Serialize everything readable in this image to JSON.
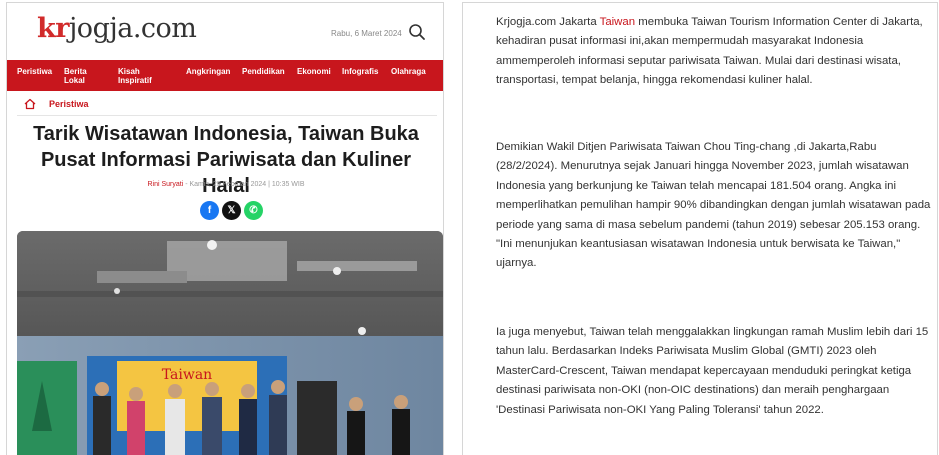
{
  "header": {
    "logo_part1": "kr",
    "logo_part2": "jogja.com",
    "date": "Rabu, 6 Maret 2024"
  },
  "nav": [
    {
      "label": "Peristiwa"
    },
    {
      "label": "Berita Lokal"
    },
    {
      "label": "Kisah Inspiratif"
    },
    {
      "label": "Angkringan"
    },
    {
      "label": "Pendidikan"
    },
    {
      "label": "Ekonomi"
    },
    {
      "label": "Infografis"
    },
    {
      "label": "Olahraga"
    }
  ],
  "breadcrumb": {
    "label": "Peristiwa"
  },
  "article": {
    "title": "Tarik Wisatawan Indonesia, Taiwan Buka Pusat Informasi Pariwisata dan Kuliner Halal",
    "author": "Rini Suryati",
    "meta_rest": " - Kamis, 29 Februari 2024 | 10:35 WIB",
    "photo_banner_text": "Taiwan",
    "p1_a": "Krjogja.com Jakarta ",
    "p1_link": "Taiwan",
    "p1_b": " membuka Taiwan Tourism Information Center di Jakarta, kehadiran pusat informasi ini,akan mempermudah masyarakat Indonesia ammemperoleh informasi seputar pariwisata Taiwan. Mulai dari destinasi wisata, transportasi, tempat belanja, hingga rekomendasi kuliner halal.",
    "p2": "Demikian Wakil Ditjen Pariwisata Taiwan Chou Ting-chang ,di Jakarta,Rabu (28/2/2024). Menurutnya sejak Januari hingga November 2023, jumlah wisatawan Indonesia yang berkunjung ke Taiwan telah mencapai 181.504 orang. Angka ini memperlihatkan pemulihan hampir 90% dibandingkan dengan jumlah wisatawan pada periode yang sama di masa sebelum pandemi (tahun 2019) sebesar 205.153 orang. \"Ini menunjukan keantusiasan wisatawan Indonesia untuk berwisata ke Taiwan,\" ujarnya.",
    "p3": "Ia juga menyebut, Taiwan telah menggalakkan lingkungan ramah Muslim lebih dari 15 tahun lalu. Berdasarkan Indeks Pariwisata Muslim Global (GMTI) 2023 oleh MasterCard-Crescent, Taiwan mendapat kepercayaan menduduki peringkat ketiga destinasi pariwisata non-OKI (non-OIC destinations) dan meraih penghargaan 'Destinasi Pariwisata non-OKI Yang Paling Toleransi' tahun 2022."
  },
  "share": [
    {
      "icon": "facebook-icon",
      "glyph": "f",
      "color": "#1877f2"
    },
    {
      "icon": "x-icon",
      "glyph": "𝕏",
      "color": "#111111"
    },
    {
      "icon": "whatsapp-icon",
      "glyph": "✆",
      "color": "#25d366"
    }
  ],
  "colors": {
    "brand_red": "#c8161d",
    "text": "#333333"
  }
}
